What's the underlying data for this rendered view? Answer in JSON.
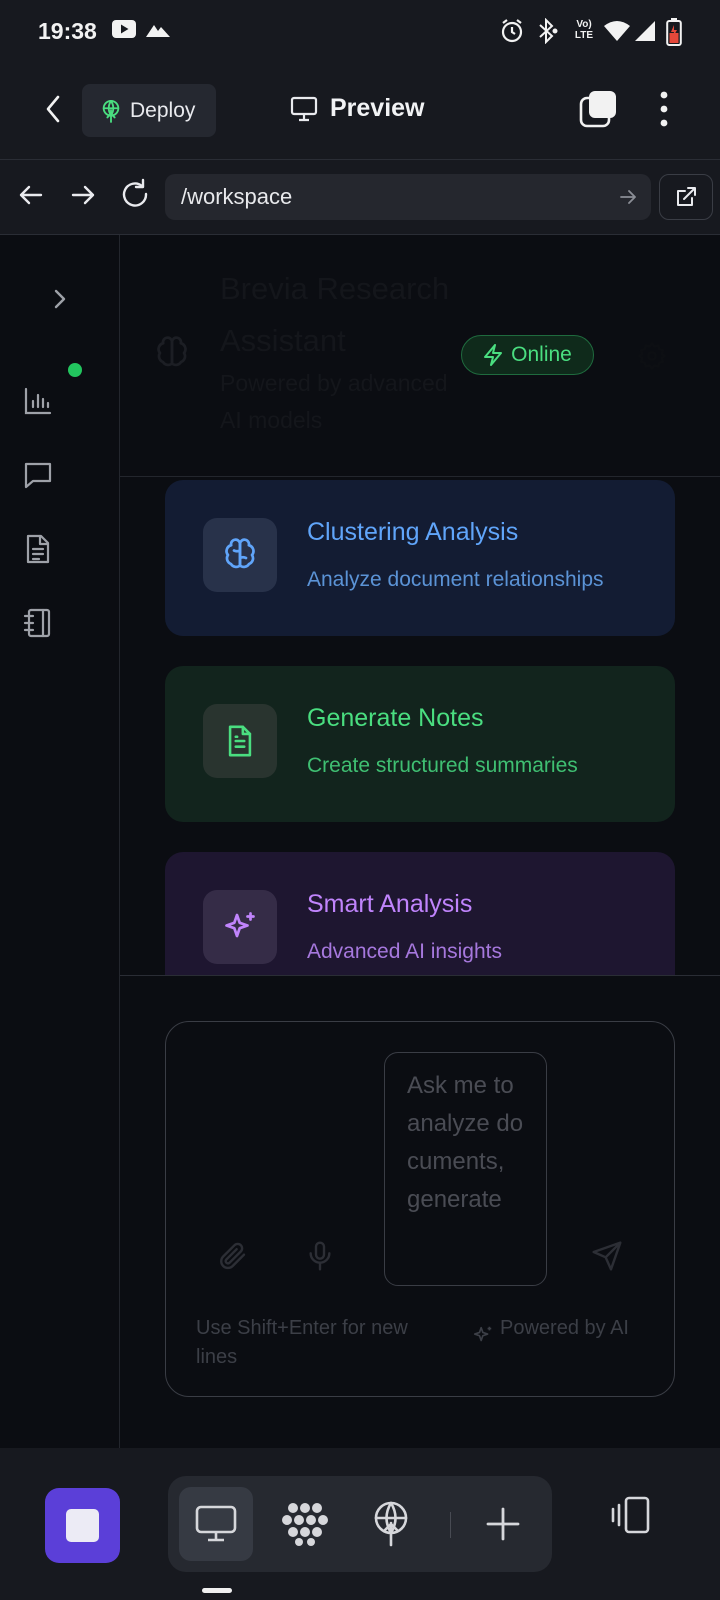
{
  "status_bar": {
    "time": "19:38",
    "net_label": "Vo) LTE"
  },
  "header": {
    "deploy_label": "Deploy",
    "title": "Preview"
  },
  "browser": {
    "url": "/workspace"
  },
  "chat": {
    "title": "Brevia Research Assistant",
    "subtitle": "Powered by advanced AI models",
    "status": "Online"
  },
  "cards": [
    {
      "title": "Clustering Analysis",
      "desc": "Analyze document relationships",
      "icon": "brain-icon",
      "color": "#60a5fa"
    },
    {
      "title": "Generate Notes",
      "desc": "Create structured summaries",
      "icon": "file-text-icon",
      "color": "#4ade80"
    },
    {
      "title": "Smart Analysis",
      "desc": "Advanced AI insights",
      "icon": "sparkles-icon",
      "color": "#c084fc"
    }
  ],
  "composer": {
    "placeholder": "Ask me to analyze documents, generate",
    "hint": "Use Shift+Enter for new lines",
    "powered": "Powered by AI"
  },
  "colors": {
    "stop_button": "#5b3fd8",
    "online": "#22c55e"
  }
}
